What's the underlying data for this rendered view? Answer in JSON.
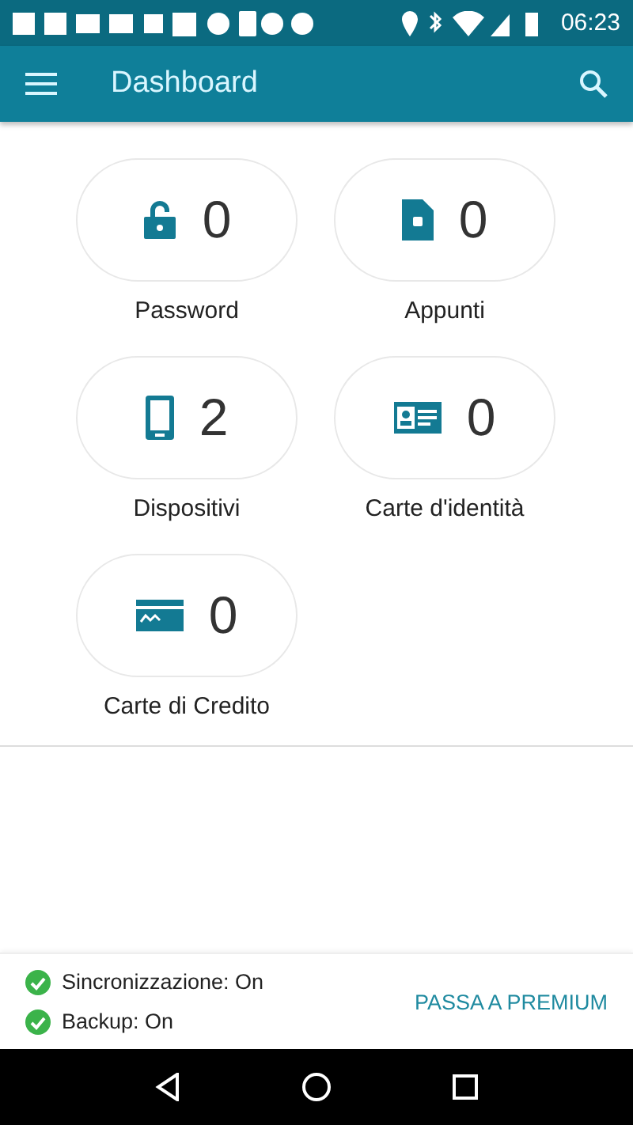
{
  "status_bar": {
    "time": "06:23"
  },
  "app_bar": {
    "title": "Dashboard"
  },
  "tiles": [
    {
      "kind": "lock",
      "count": "0",
      "label": "Password"
    },
    {
      "kind": "note",
      "count": "0",
      "label": "Appunti"
    },
    {
      "kind": "phone",
      "count": "2",
      "label": "Dispositivi"
    },
    {
      "kind": "id",
      "count": "0",
      "label": "Carte d'identità"
    },
    {
      "kind": "card",
      "count": "0",
      "label": "Carte di Credito"
    }
  ],
  "footer": {
    "statuses": [
      {
        "label": "Sincronizzazione: On"
      },
      {
        "label": "Backup: On"
      }
    ],
    "action": "PASSA A PREMIUM"
  }
}
